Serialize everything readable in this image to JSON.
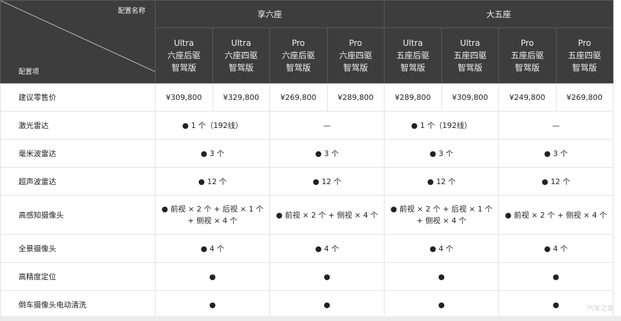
{
  "header": {
    "corner_top": "配置名称",
    "corner_bottom": "配置项",
    "groups": [
      "享六座",
      "大五座"
    ],
    "variants": [
      {
        "line1": "Ultra",
        "line2": "六座后驱",
        "line3": "智驾版"
      },
      {
        "line1": "Ultra",
        "line2": "六座四驱",
        "line3": "智驾版"
      },
      {
        "line1": "Pro",
        "line2": "六座后驱",
        "line3": "智驾版"
      },
      {
        "line1": "Pro",
        "line2": "六座四驱",
        "line3": "智驾版"
      },
      {
        "line1": "Ultra",
        "line2": "五座后驱",
        "line3": "智驾版"
      },
      {
        "line1": "Ultra",
        "line2": "五座四驱",
        "line3": "智驾版"
      },
      {
        "line1": "Pro",
        "line2": "五座后驱",
        "line3": "智驾版"
      },
      {
        "line1": "Pro",
        "line2": "五座四驱",
        "line3": "智驾版"
      }
    ]
  },
  "rows": [
    {
      "label": "建议零售价",
      "cells": [
        "¥309,800",
        "¥329,800",
        "¥269,800",
        "¥289,800",
        "¥289,800",
        "¥309,800",
        "¥249,800",
        "¥269,800"
      ]
    },
    {
      "label": "激光雷达",
      "cells": [
        "● 1 个（192线）",
        "—",
        "● 1 个（192线）",
        "—"
      ]
    },
    {
      "label": "毫米波雷达",
      "cells": [
        "● 3 个",
        "● 3 个",
        "● 3 个",
        "● 3 个"
      ]
    },
    {
      "label": "超声波雷达",
      "cells": [
        "● 12 个",
        "● 12 个",
        "● 12 个",
        "● 12 个"
      ]
    },
    {
      "label": "高感知摄像头",
      "cells": [
        "● 前视 × 2 个 + 后视 × 1 个 + 侧视 × 4 个",
        "● 前视 × 2 个 + 侧视 × 4 个",
        "● 前视 × 2 个 + 后视 × 1 个 + 侧视 × 4 个",
        "● 前视 × 2 个 + 侧视 × 4 个"
      ]
    },
    {
      "label": "全景摄像头",
      "cells": [
        "● 4 个",
        "● 4 个",
        "● 4 个",
        "● 4 个"
      ]
    },
    {
      "label": "高精度定位",
      "cells": [
        "●",
        "●",
        "●",
        "●"
      ]
    },
    {
      "label": "倒车摄像头电动清洗",
      "cells": [
        "●",
        "●",
        "●",
        "●"
      ]
    }
  ],
  "watermark": "汽车之家"
}
